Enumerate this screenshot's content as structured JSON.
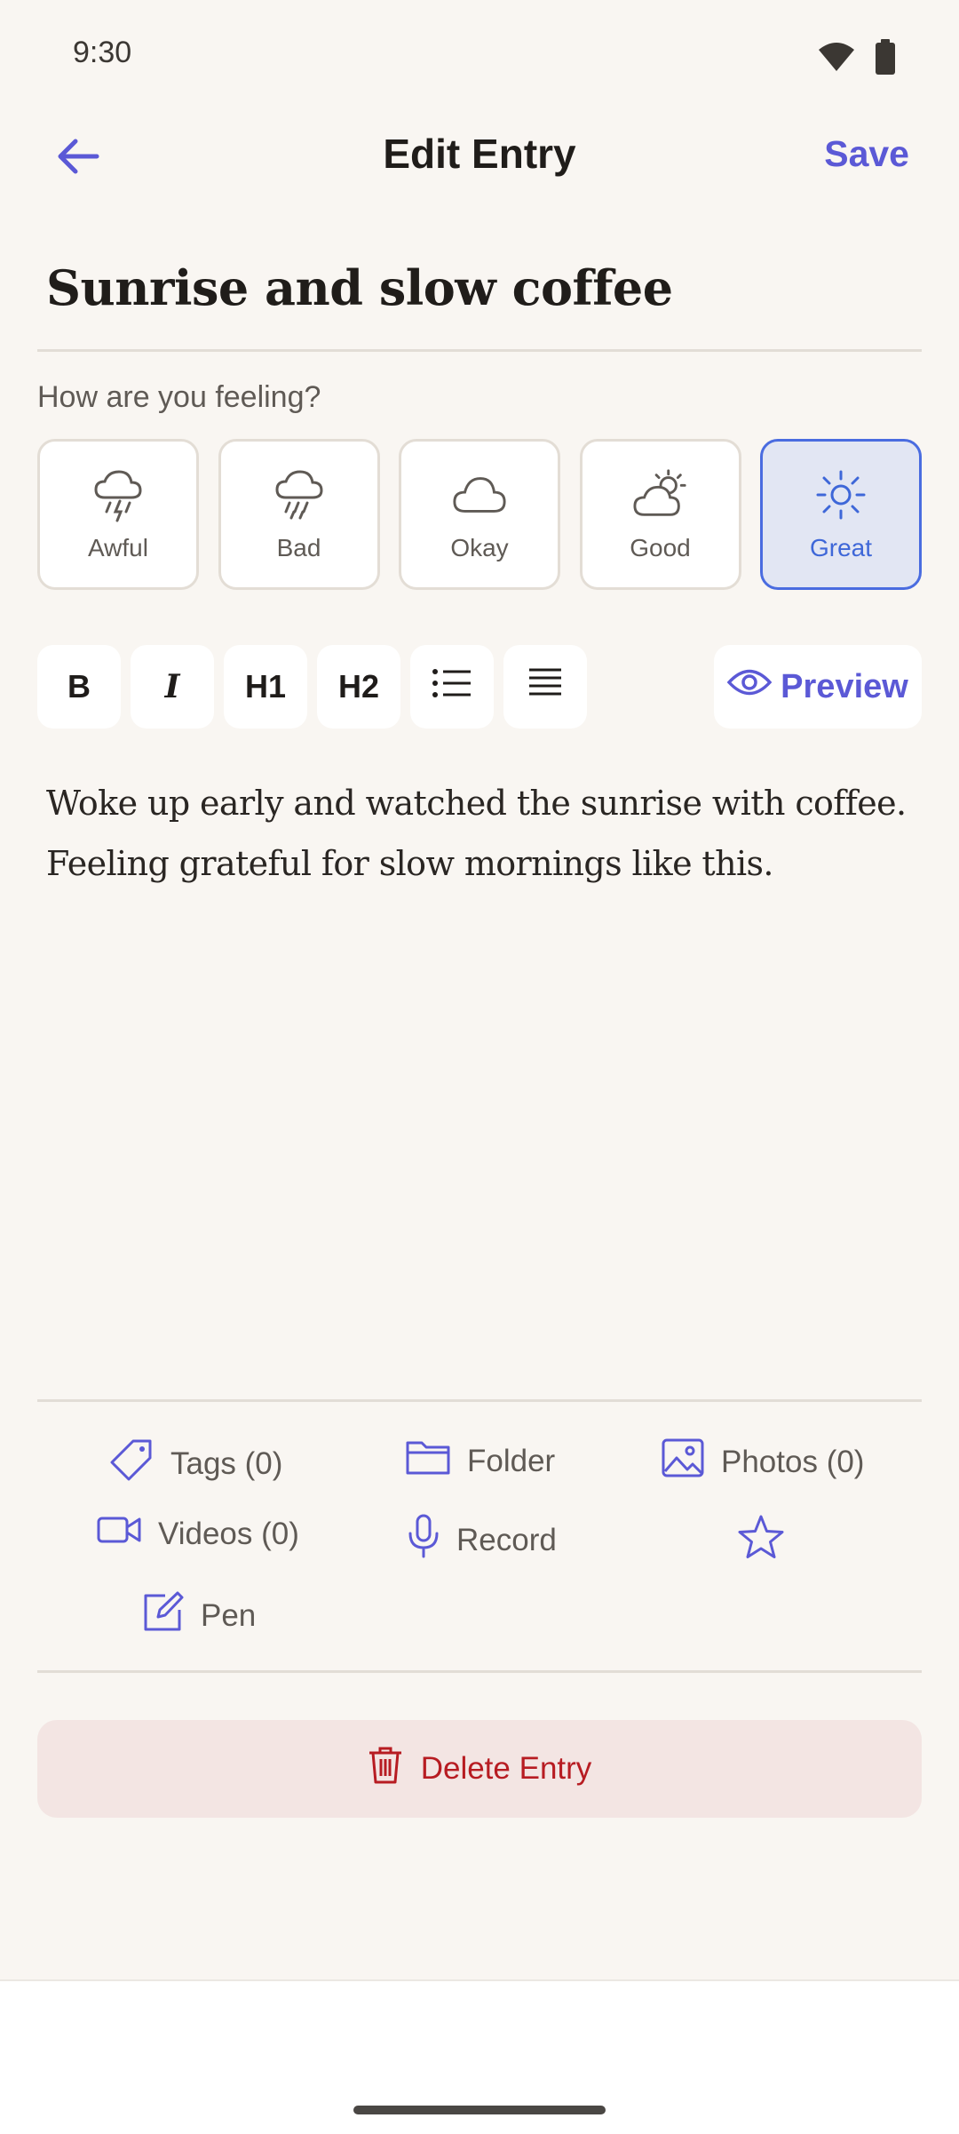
{
  "status_bar": {
    "time": "9:30",
    "icons": [
      "wifi-icon",
      "battery-icon"
    ]
  },
  "app_bar": {
    "back_icon": "arrow-left-icon",
    "title": "Edit Entry",
    "save_label": "Save"
  },
  "entry": {
    "title": "Sunrise and slow coffee",
    "body_lines": [
      "Woke up early and watched the sunrise with coffee.",
      "Feeling grateful for slow mornings like this."
    ]
  },
  "mood": {
    "question": "How are you feeling?",
    "selected": "Great",
    "options": [
      {
        "label": "Awful",
        "icon": "thunderstorm-icon"
      },
      {
        "label": "Bad",
        "icon": "rain-cloud-icon"
      },
      {
        "label": "Okay",
        "icon": "cloud-icon"
      },
      {
        "label": "Good",
        "icon": "partly-sunny-icon"
      },
      {
        "label": "Great",
        "icon": "sun-icon"
      }
    ]
  },
  "toolbar": {
    "bold": "B",
    "italic": "I",
    "h1": "H1",
    "h2": "H2",
    "bullet_list_icon": "bullet-list-icon",
    "align_icon": "align-justify-icon",
    "preview_label": "Preview",
    "preview_icon": "eye-icon"
  },
  "attachments": {
    "tags": "Tags (0)",
    "folder": "Folder",
    "photos": "Photos (0)",
    "videos": "Videos (0)",
    "record": "Record",
    "favorite_icon": "star-icon",
    "pen": "Pen"
  },
  "delete": {
    "label": "Delete Entry",
    "icon": "trash-icon"
  },
  "colors": {
    "accent": "#5b59d6",
    "selected_mood": "#3e67d8",
    "danger": "#b71c22",
    "background": "#f9f6f2"
  }
}
